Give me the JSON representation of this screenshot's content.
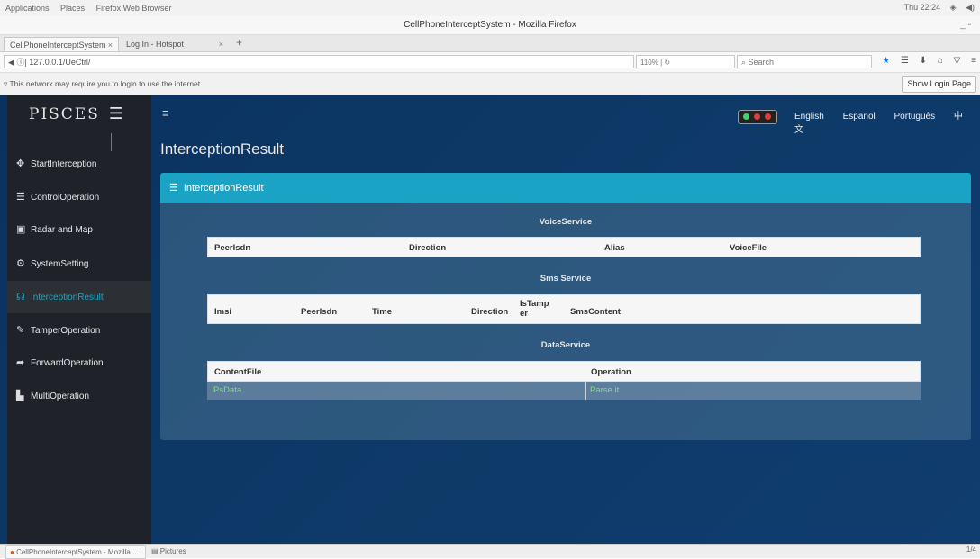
{
  "os_bar": {
    "applications": "Applications",
    "places": "Places",
    "browser": "Firefox Web Browser",
    "clock": "Thu 22:24"
  },
  "window": {
    "title": "CellPhoneInterceptSystem - Mozilla Firefox"
  },
  "tabs": [
    {
      "label": "CellPhoneInterceptSystem"
    },
    {
      "label": "Log In - Hotspot"
    }
  ],
  "browser": {
    "url": "127.0.0.1/UeCtrl/",
    "zoom": "110%",
    "search_placeholder": "Search",
    "notification": "This network may require you to login to use the internet.",
    "show_login": "Show Login Page"
  },
  "app": {
    "brand": "PISCES",
    "nav": [
      {
        "label": "StartInterception",
        "icon": "crosshair-icon"
      },
      {
        "label": "ControlOperation",
        "icon": "list-icon"
      },
      {
        "label": "Radar and Map",
        "icon": "camera-icon"
      },
      {
        "label": "SystemSetting",
        "icon": "gears-icon"
      },
      {
        "label": "InterceptionResult",
        "icon": "headset-icon",
        "active": true
      },
      {
        "label": "TamperOperation",
        "icon": "edit-icon"
      },
      {
        "label": "ForwardOperation",
        "icon": "share-icon"
      },
      {
        "label": "MultiOperation",
        "icon": "bar-chart-icon"
      }
    ],
    "languages": [
      "English",
      "Espanol",
      "Português",
      "中文"
    ],
    "signal_colors": {
      "on": "#3fd46a",
      "off": "#e23c3c"
    }
  },
  "main": {
    "page_title": "InterceptionResult",
    "panel_title": "InterceptionResult",
    "voice": {
      "title": "VoiceService",
      "columns": [
        "PeerIsdn",
        "Direction",
        "Alias",
        "VoiceFile"
      ]
    },
    "sms": {
      "title": "Sms Service",
      "columns": [
        "Imsi",
        "PeerIsdn",
        "Time",
        "Direction",
        "IsTamper",
        "SmsContent"
      ]
    },
    "data": {
      "title": "DataService",
      "columns": [
        "ContentFile",
        "Operation"
      ],
      "rows": [
        {
          "content_file": "PsData",
          "operation": "Parse it"
        }
      ]
    }
  },
  "statusbar": {
    "task": "CellPhoneInterceptSystem - Mozilla ...",
    "pictures": "Pictures",
    "page": "1/4"
  },
  "colors": {
    "accent": "#1aa3c4",
    "sidebar": "#1f2329",
    "link_green": "#7ee07e"
  }
}
